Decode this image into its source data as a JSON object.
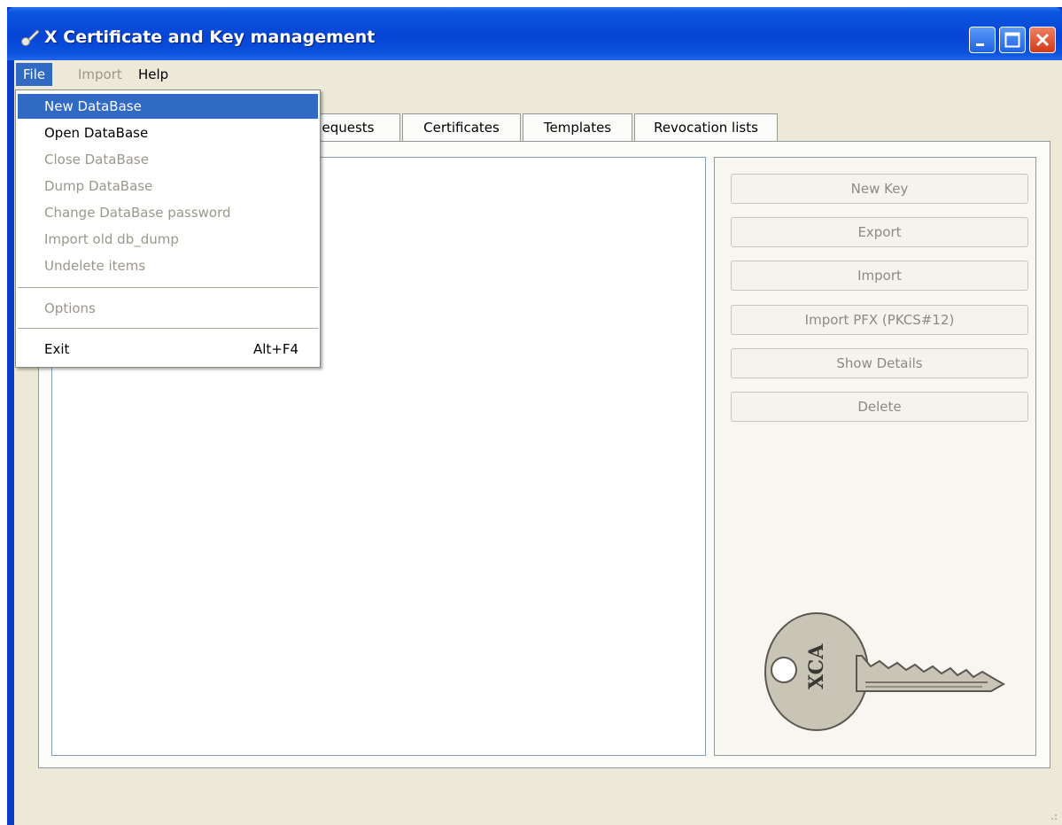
{
  "window": {
    "title": "X Certificate and Key management"
  },
  "menubar": {
    "items": [
      {
        "label": "File",
        "state": "active"
      },
      {
        "label": "Import",
        "state": "disabled"
      },
      {
        "label": "Help",
        "state": "normal"
      }
    ]
  },
  "tabs": [
    {
      "label": "equests"
    },
    {
      "label": "Certificates"
    },
    {
      "label": "Templates"
    },
    {
      "label": "Revocation lists"
    }
  ],
  "side_panel": {
    "buttons": [
      {
        "label": "New Key"
      },
      {
        "label": "Export"
      },
      {
        "label": "Import"
      },
      {
        "label": "Import PFX (PKCS#12)"
      },
      {
        "label": "Show Details"
      },
      {
        "label": "Delete"
      }
    ],
    "key_image_text": "XCA"
  },
  "file_menu": {
    "items": [
      {
        "label": "New DataBase",
        "state": "highlighted"
      },
      {
        "label": "Open DataBase",
        "state": "enabled"
      },
      {
        "label": "Close DataBase",
        "state": "disabled"
      },
      {
        "label": "Dump DataBase",
        "state": "disabled"
      },
      {
        "label": "Change DataBase password",
        "state": "disabled"
      },
      {
        "label": "Import old db_dump",
        "state": "disabled"
      },
      {
        "label": "Undelete items",
        "state": "disabled"
      },
      {
        "label": "Options",
        "state": "disabled"
      },
      {
        "label": "Exit",
        "state": "enabled",
        "shortcut": "Alt+F4"
      }
    ]
  },
  "colors": {
    "titlebar": "#0644d6",
    "highlight": "#316ac5",
    "disabled_text": "#9a978a",
    "window_background": "#ece9d8"
  }
}
